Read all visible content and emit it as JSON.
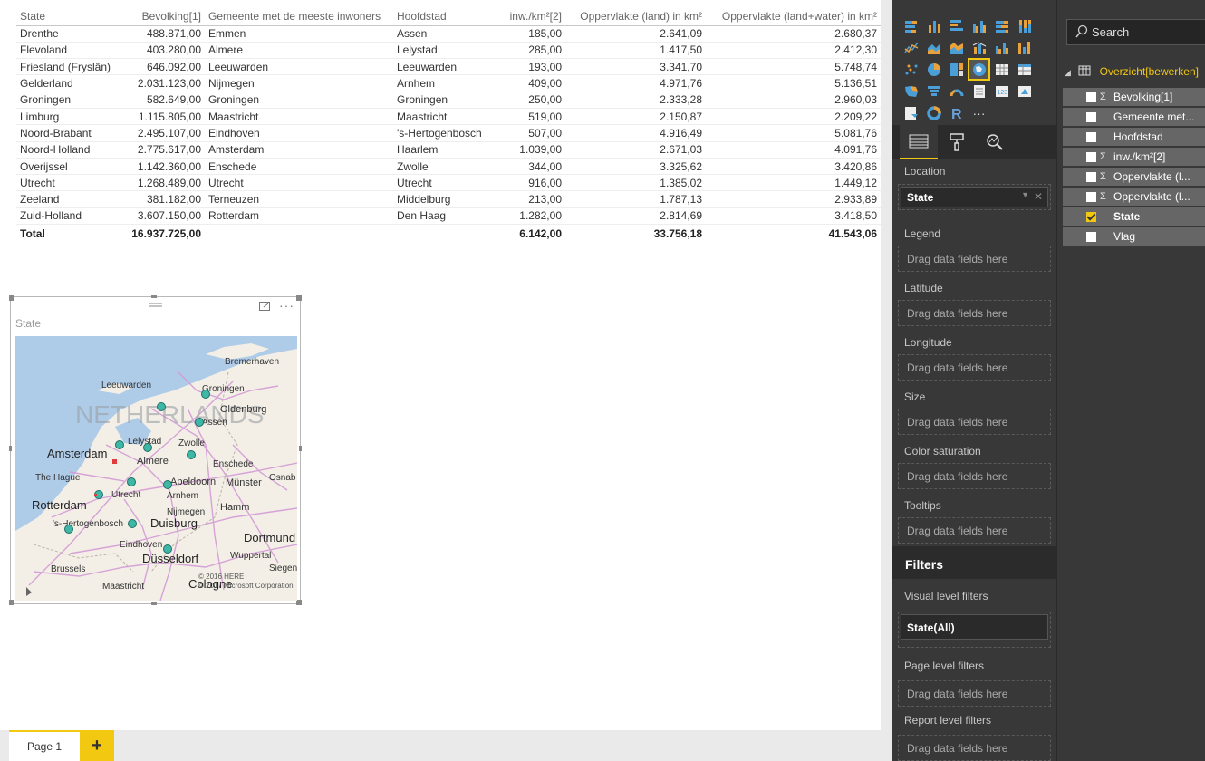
{
  "table": {
    "headers": [
      "State",
      "Bevolking[1]",
      "Gemeente met de meeste inwoners",
      "Hoofdstad",
      "inw./km²[2]",
      "Oppervlakte (land) in km²",
      "Oppervlakte (land+water) in km²"
    ],
    "rows": [
      [
        "Drenthe",
        "488.871,00",
        "Emmen",
        "Assen",
        "185,00",
        "2.641,09",
        "2.680,37"
      ],
      [
        "Flevoland",
        "403.280,00",
        "Almere",
        "Lelystad",
        "285,00",
        "1.417,50",
        "2.412,30"
      ],
      [
        "Friesland (Fryslân)",
        "646.092,00",
        "Leeuwarden",
        "Leeuwarden",
        "193,00",
        "3.341,70",
        "5.748,74"
      ],
      [
        "Gelderland",
        "2.031.123,00",
        "Nijmegen",
        "Arnhem",
        "409,00",
        "4.971,76",
        "5.136,51"
      ],
      [
        "Groningen",
        "582.649,00",
        "Groningen",
        "Groningen",
        "250,00",
        "2.333,28",
        "2.960,03"
      ],
      [
        "Limburg",
        "1.115.805,00",
        "Maastricht",
        "Maastricht",
        "519,00",
        "2.150,87",
        "2.209,22"
      ],
      [
        "Noord-Brabant",
        "2.495.107,00",
        "Eindhoven",
        "'s-Hertogenbosch",
        "507,00",
        "4.916,49",
        "5.081,76"
      ],
      [
        "Noord-Holland",
        "2.775.617,00",
        "Amsterdam",
        "Haarlem",
        "1.039,00",
        "2.671,03",
        "4.091,76"
      ],
      [
        "Overijssel",
        "1.142.360,00",
        "Enschede",
        "Zwolle",
        "344,00",
        "3.325,62",
        "3.420,86"
      ],
      [
        "Utrecht",
        "1.268.489,00",
        "Utrecht",
        "Utrecht",
        "916,00",
        "1.385,02",
        "1.449,12"
      ],
      [
        "Zeeland",
        "381.182,00",
        "Terneuzen",
        "Middelburg",
        "213,00",
        "1.787,13",
        "2.933,89"
      ],
      [
        "Zuid-Holland",
        "3.607.150,00",
        "Rotterdam",
        "Den Haag",
        "1.282,00",
        "2.814,69",
        "3.418,50"
      ]
    ],
    "total": [
      "Total",
      "16.937.725,00",
      "",
      "",
      "6.142,00",
      "33.756,18",
      "41.543,06"
    ]
  },
  "map": {
    "title": "State",
    "country_label": "NETHERLANDS",
    "copyright_here": "© 2016 HERE",
    "copyright_ms": "© 2017 Microsoft Corporation",
    "cities": [
      "Bremerhaven",
      "Leeuwarden",
      "Groningen",
      "Oldenburg",
      "Assen",
      "Lelystad",
      "Zwolle",
      "Amsterdam",
      "Almere",
      "Enschede",
      "The Hague",
      "Apeldoorn",
      "Münster",
      "Osnab",
      "Utrecht",
      "Arnhem",
      "Rotterdam",
      "Nijmegen",
      "Hamm",
      "'s-Hertogenbosch",
      "Duisburg",
      "Dortmund",
      "Eindhoven",
      "Wuppertal",
      "Düsseldorf",
      "Brussels",
      "Maastricht",
      "Cologne",
      "Siegen"
    ]
  },
  "pages": {
    "tab_label": "Page 1",
    "add_label": "+"
  },
  "viz": {
    "location_label": "Location",
    "location_value": "State",
    "wells": [
      {
        "label": "Legend",
        "placeholder": "Drag data fields here"
      },
      {
        "label": "Latitude",
        "placeholder": "Drag data fields here"
      },
      {
        "label": "Longitude",
        "placeholder": "Drag data fields here"
      },
      {
        "label": "Size",
        "placeholder": "Drag data fields here"
      },
      {
        "label": "Color saturation",
        "placeholder": "Drag data fields here"
      },
      {
        "label": "Tooltips",
        "placeholder": "Drag data fields here"
      }
    ],
    "filters_title": "Filters",
    "visual_filters_label": "Visual level filters",
    "visual_filter_value": "State(All)",
    "page_filters_label": "Page level filters",
    "page_filters_placeholder": "Drag data fields here",
    "report_filters_label": "Report level filters",
    "report_filters_placeholder": "Drag data fields here"
  },
  "fields": {
    "search_placeholder": "Search",
    "table_name": "Overzicht[bewerken]",
    "items": [
      {
        "name": "Bevolking[1]",
        "sigma": true,
        "checked": false
      },
      {
        "name": "Gemeente met...",
        "sigma": false,
        "checked": false
      },
      {
        "name": "Hoofdstad",
        "sigma": false,
        "checked": false
      },
      {
        "name": "inw./km²[2]",
        "sigma": true,
        "checked": false
      },
      {
        "name": "Oppervlakte (l...",
        "sigma": true,
        "checked": false
      },
      {
        "name": "Oppervlakte (l...",
        "sigma": true,
        "checked": false
      },
      {
        "name": "State",
        "sigma": false,
        "checked": true
      },
      {
        "name": "Vlag",
        "sigma": false,
        "checked": false
      }
    ]
  },
  "colors": {
    "accent": "#f2c811",
    "pane_bg": "#383838",
    "dot": "#3fb7a6"
  }
}
